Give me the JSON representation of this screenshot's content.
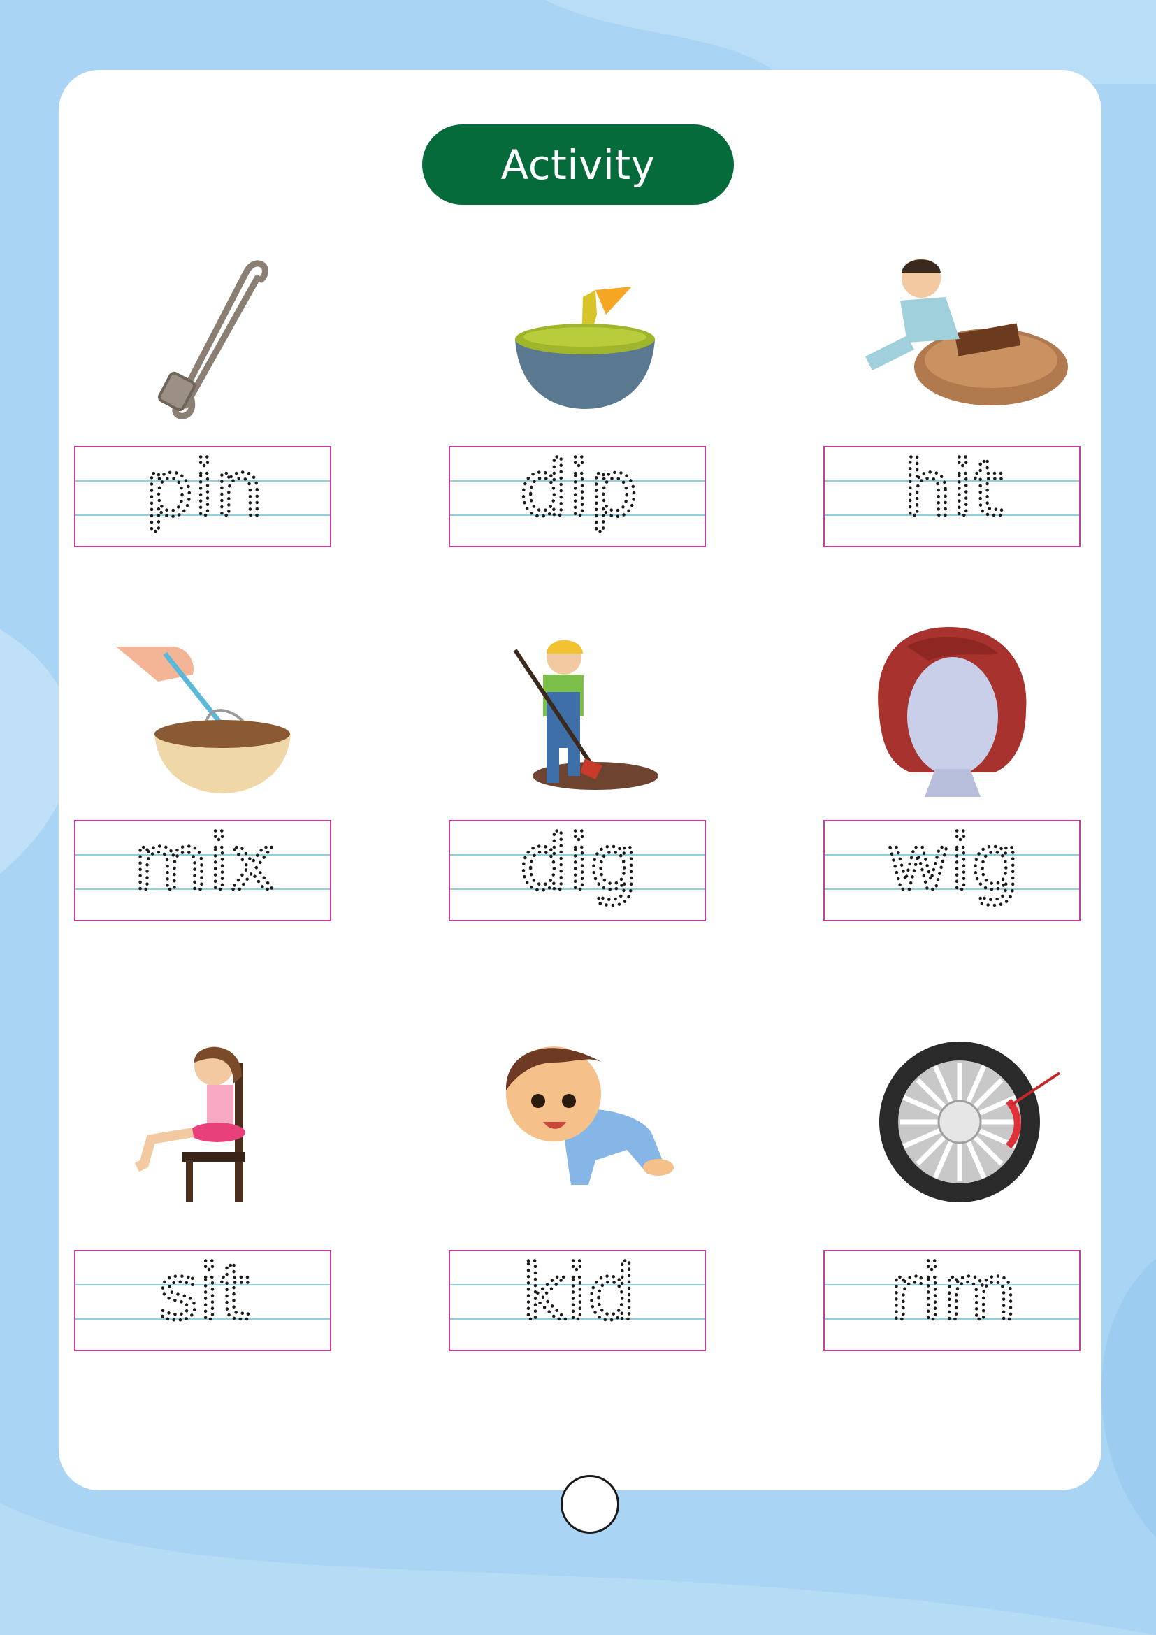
{
  "title": "Activity",
  "colors": {
    "background": "#a9d4f4",
    "title_pill": "#056b3a",
    "trace_border": "#c0409a",
    "guide_line": "#8ecfe0"
  },
  "items": [
    {
      "word": "pin",
      "icon": "safety-pin-icon"
    },
    {
      "word": "dip",
      "icon": "bowl-dip-icon"
    },
    {
      "word": "hit",
      "icon": "boy-hitting-pillow-icon"
    },
    {
      "word": "mix",
      "icon": "whisk-bowl-icon"
    },
    {
      "word": "dig",
      "icon": "boy-digging-icon"
    },
    {
      "word": "wig",
      "icon": "red-wig-icon"
    },
    {
      "word": "sit",
      "icon": "girl-sitting-chair-icon"
    },
    {
      "word": "kid",
      "icon": "crawling-kid-icon"
    },
    {
      "word": "rim",
      "icon": "wheel-rim-icon"
    }
  ]
}
